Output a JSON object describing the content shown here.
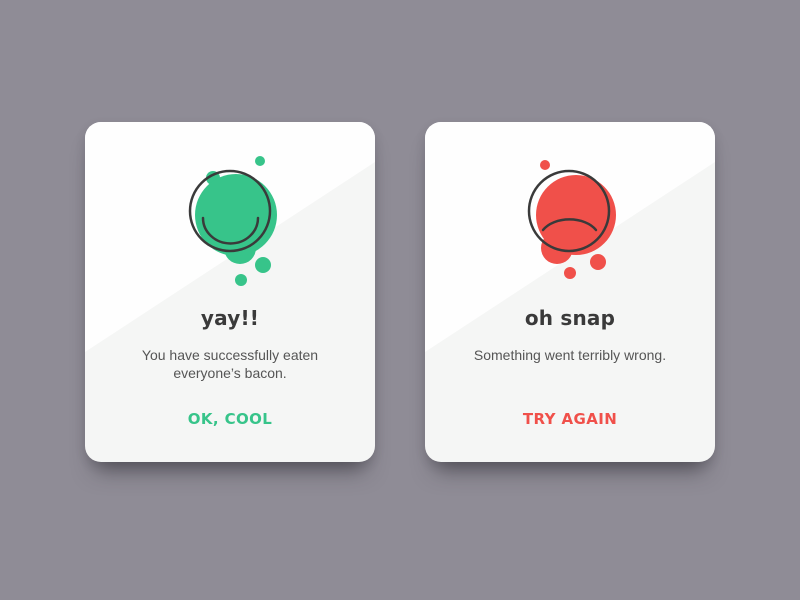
{
  "cards": [
    {
      "title": "yay!!",
      "message": "You have successfully eaten everyone’s bacon.",
      "action_label": "OK, COOL",
      "accent_color": "#37c48a",
      "icon": "smiley-face-icon"
    },
    {
      "title": "oh snap",
      "message": "Something went terribly wrong.",
      "action_label": "TRY AGAIN",
      "accent_color": "#f0504a",
      "icon": "sad-face-icon"
    }
  ],
  "colors": {
    "background": "#8f8c96",
    "card": "#f5f6f5",
    "text_dark": "#3a3a3a"
  }
}
